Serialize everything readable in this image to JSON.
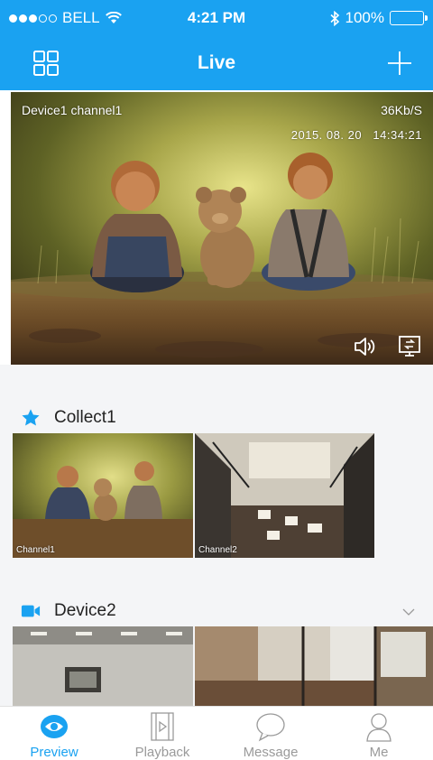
{
  "colors": {
    "brand": "#1aa2f1",
    "background": "#f4f5f7",
    "inactive": "#9a9a9a"
  },
  "status_bar": {
    "carrier": "BELL",
    "time": "4:21 PM",
    "battery": "100%"
  },
  "nav": {
    "title": "Live",
    "left_icon": "grid-icon",
    "right_icon": "plus-icon"
  },
  "live": {
    "device": "Device1 channel1",
    "rate": "36Kb/S",
    "timestamp": "2015. 08. 20   14:34:21",
    "icons": [
      "speaker-icon",
      "screen-icon"
    ]
  },
  "sections": [
    {
      "icon": "star-icon",
      "title": "Collect1",
      "thumbs": [
        {
          "label": "Channel1"
        },
        {
          "label": "Channel2"
        }
      ]
    },
    {
      "icon": "video-camera-icon",
      "title": "Device2",
      "thumbs": [
        {
          "label": ""
        },
        {
          "label": ""
        }
      ]
    }
  ],
  "tabs": [
    {
      "label": "Preview",
      "icon": "eye-icon",
      "active": true
    },
    {
      "label": "Playback",
      "icon": "film-play-icon",
      "active": false
    },
    {
      "label": "Message",
      "icon": "speech-bubble-icon",
      "active": false
    },
    {
      "label": "Me",
      "icon": "person-icon",
      "active": false
    }
  ]
}
